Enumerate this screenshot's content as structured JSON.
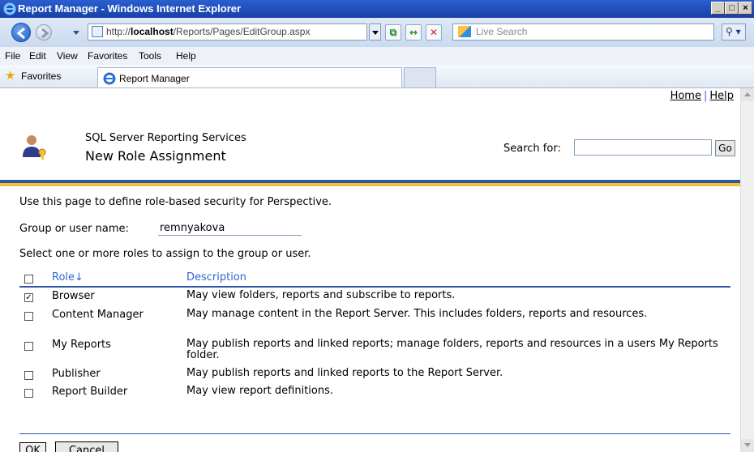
{
  "window": {
    "title": "Report Manager - Windows Internet Explorer"
  },
  "browser": {
    "url_prefix": "http://",
    "url_host": "localhost",
    "url_path": "/Reports/Pages/EditGroup.aspx",
    "search_placeholder": "Live Search",
    "menu": [
      "File",
      "Edit",
      "View",
      "Favorites",
      "Tools",
      "Help"
    ],
    "favorites_label": "Favorites",
    "tab_label": "Report Manager"
  },
  "header": {
    "links": {
      "home": "Home",
      "separator": "|",
      "help": "Help"
    },
    "subtitle": "SQL Server Reporting Services",
    "title": "New Role Assignment",
    "search_label": "Search for:",
    "search_value": "",
    "go_label": "Go"
  },
  "form": {
    "intro": "Use this page to define role-based security for Perspective.",
    "user_label": "Group or user name:",
    "user_value": "remnyakova",
    "select_text": "Select one or more roles to assign to the group or user.",
    "columns": {
      "role": "Role↓",
      "description": "Description"
    },
    "roles": [
      {
        "name": "Browser",
        "description": "May view folders, reports and subscribe to reports.",
        "checked": true
      },
      {
        "name": "Content Manager",
        "description": "May manage content in the Report Server.  This includes folders, reports and resources.",
        "checked": false
      },
      {
        "name": "My Reports",
        "description": "May publish reports and linked reports; manage folders, reports and resources in a users My Reports folder.",
        "checked": false
      },
      {
        "name": "Publisher",
        "description": "May publish reports and linked reports to the Report Server.",
        "checked": false
      },
      {
        "name": "Report Builder",
        "description": "May view report definitions.",
        "checked": false
      }
    ],
    "ok_label": "OK",
    "cancel_label": "Cancel"
  }
}
